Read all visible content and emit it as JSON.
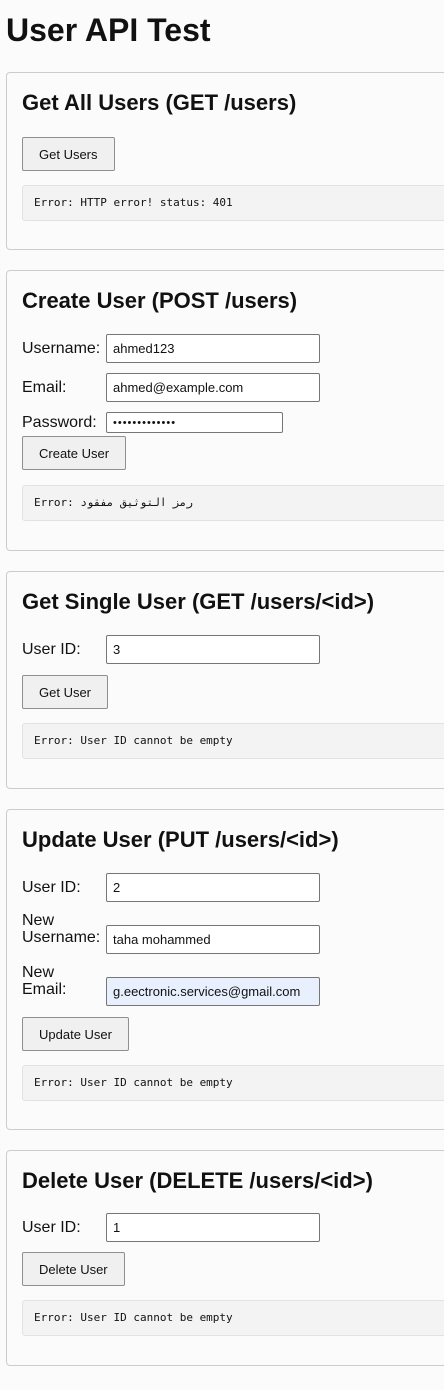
{
  "page_title": "User API Test",
  "get_all": {
    "heading": "Get All Users (GET /users)",
    "button": "Get Users",
    "output": "Error: HTTP error! status: 401"
  },
  "create": {
    "heading": "Create User (POST /users)",
    "username_label": "Username:",
    "username_value": "ahmed123",
    "email_label": "Email:",
    "email_value": "ahmed@example.com",
    "password_label": "Password:",
    "password_value": "•••••••••••••",
    "button": "Create User",
    "output": "Error: رمز التوثيق مفقود"
  },
  "get_single": {
    "heading": "Get Single User (GET /users/<id>)",
    "id_label": "User ID:",
    "id_value": "3",
    "button": "Get User",
    "output": "Error: User ID cannot be empty"
  },
  "update": {
    "heading": "Update User (PUT /users/<id>)",
    "id_label": "User ID:",
    "id_value": "2",
    "username_label": "New Username:",
    "username_value": "taha mohammed",
    "email_label": "New Email:",
    "email_value": "g.eectronic.services@gmail.com",
    "button": "Update User",
    "output": "Error: User ID cannot be empty"
  },
  "delete": {
    "heading": "Delete User (DELETE /users/<id>)",
    "id_label": "User ID:",
    "id_value": "1",
    "button": "Delete User",
    "output": "Error: User ID cannot be empty"
  }
}
